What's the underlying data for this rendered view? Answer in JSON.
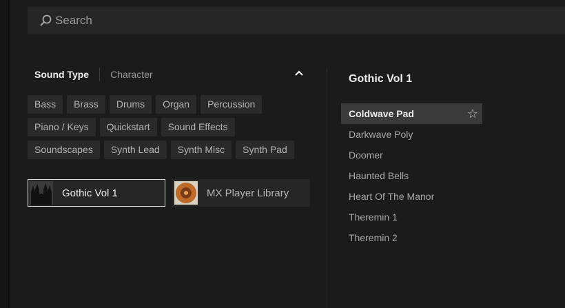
{
  "search": {
    "placeholder": "Search"
  },
  "filter_tabs": {
    "active": "Sound Type",
    "other": "Character"
  },
  "tags": [
    "Bass",
    "Brass",
    "Drums",
    "Organ",
    "Percussion",
    "Piano / Keys",
    "Quickstart",
    "Sound Effects",
    "Soundscapes",
    "Synth Lead",
    "Synth Misc",
    "Synth Pad"
  ],
  "libraries": [
    {
      "name": "Gothic Vol 1",
      "selected": true
    },
    {
      "name": "MX Player Library",
      "selected": false
    }
  ],
  "right": {
    "title": "Gothic Vol 1",
    "presets": [
      "Coldwave Pad",
      "Darkwave Poly",
      "Doomer",
      "Haunted Bells",
      "Heart Of The Manor",
      "Theremin 1",
      "Theremin 2"
    ]
  }
}
